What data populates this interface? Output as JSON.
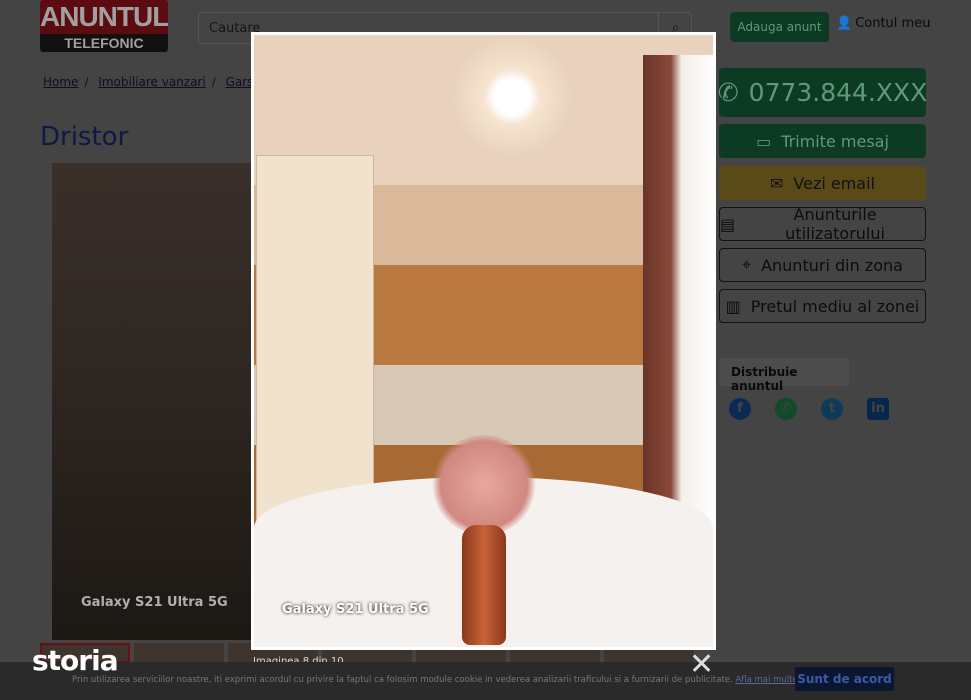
{
  "header": {
    "logo_top": "ANUNTUL",
    "logo_bottom": "TELEFONIC",
    "search_placeholder": "Cautare",
    "add_button": "Adauga anunt",
    "account": "Contul meu"
  },
  "breadcrumb": [
    "Home",
    "Imobiliare vanzari",
    "Garson"
  ],
  "title": "Dristor",
  "gallery": {
    "caption": "Galaxy S21 Ultra 5G"
  },
  "sidebar": {
    "phone": "0773.844.XXX",
    "message": "Trimite mesaj",
    "email": "Vezi email",
    "user_ads": "Anunturile utilizatorului",
    "zone_ads": "Anunturi din zona",
    "avg_price": "Pretul mediu al zonei",
    "share_title": "Distribuie anuntul"
  },
  "lightbox": {
    "caption": "Galaxy S21 Ultra 5G",
    "counter": "Imaginea 8 din 10",
    "close": "✕"
  },
  "cookie": {
    "brand": "storia",
    "text": "Prin utilizarea serviciilor noastre, iti exprimi acordul cu privire la faptul ca folosim module cookie in vederea analizarii traficului si a furnizarii de publicitate.",
    "link": "Afla mai multe detalii",
    "accept": "Sunt de acord"
  }
}
